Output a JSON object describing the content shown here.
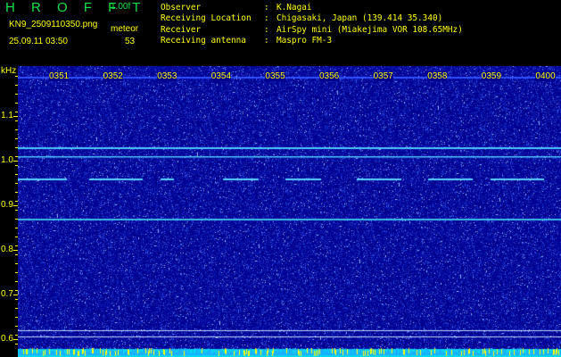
{
  "header": {
    "app_title": "H R O F F T",
    "version": "1.00f",
    "filename": "KN9_2509110350.png",
    "datetime": "25.09.11 03:50",
    "meteor_label": "meteor",
    "meteor_count": "53"
  },
  "info": [
    {
      "key": "Observer",
      "value": "K.Nagai"
    },
    {
      "key": "Receiving Location",
      "value": "Chigasaki, Japan (139.414 35.340)"
    },
    {
      "key": "Receiver",
      "value": "AirSpy mini (Miakejima VOR 108.65MHz)"
    },
    {
      "key": "Receiving antenna",
      "value": "Maspro FM-3"
    }
  ],
  "axis": {
    "unit": "kHz",
    "y_ticks": [
      "1.1",
      "1.0",
      "0.9",
      "0.8",
      "0.7",
      "0.6"
    ],
    "time_labels": [
      "0351",
      "0352",
      "0353",
      "0354",
      "0355",
      "0356",
      "0357",
      "0358",
      "0359",
      "0400"
    ]
  },
  "colors": {
    "text": "#ffff00",
    "title": "#13e04a",
    "background": "#00008c",
    "signal": "#4fc8ff",
    "floor": "#00d8f0"
  },
  "spectrogram": {
    "freq_range_khz": [
      0.6,
      1.2
    ],
    "lines_khz": [
      1.03,
      1.01,
      0.96,
      0.87,
      0.6
    ]
  }
}
